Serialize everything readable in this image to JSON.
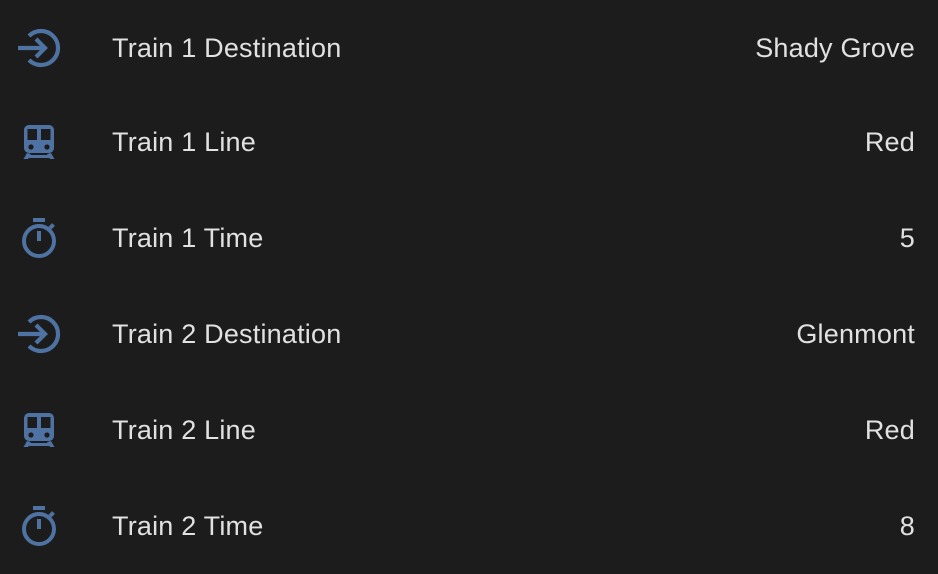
{
  "theme": {
    "background": "#1c1c1c",
    "text": "#e1e1e1",
    "icon": "#4e73a2"
  },
  "entities": [
    {
      "icon": "login-icon",
      "name": "Train 1 Destination",
      "value": "Shady Grove"
    },
    {
      "icon": "train-icon",
      "name": "Train 1 Line",
      "value": "Red"
    },
    {
      "icon": "timer-icon",
      "name": "Train 1 Time",
      "value": "5"
    },
    {
      "icon": "login-icon",
      "name": "Train 2 Destination",
      "value": "Glenmont"
    },
    {
      "icon": "train-icon",
      "name": "Train 2 Line",
      "value": "Red"
    },
    {
      "icon": "timer-icon",
      "name": "Train 2 Time",
      "value": "8"
    }
  ]
}
